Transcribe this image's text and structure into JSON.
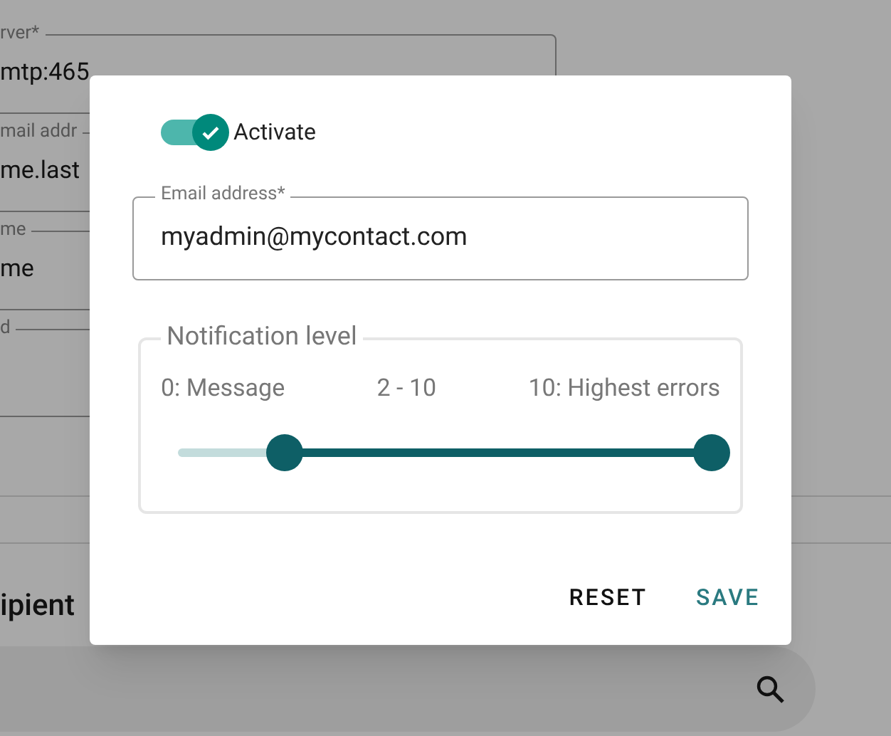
{
  "background_form": {
    "fields": [
      {
        "label": "rver*",
        "value": "mtp:465"
      },
      {
        "label": "mail addr",
        "value": "me.last"
      },
      {
        "label": "me",
        "value": "me"
      },
      {
        "label": "d"
      }
    ]
  },
  "section_title": "ipient",
  "dialog": {
    "activate": {
      "label": "Activate",
      "on": true
    },
    "email": {
      "label": "Email address*",
      "value": "myadmin@mycontact.com"
    },
    "notification": {
      "title": "Notification level",
      "labels": [
        "0: Message",
        "2 - 10",
        "10: Highest errors"
      ],
      "thumbs": [
        {
          "level": 0.2
        },
        {
          "level": 1
        }
      ]
    },
    "buttons": [
      {
        "label": "RESET",
        "kind": "plain"
      },
      {
        "label": "SAVE",
        "kind": "primary"
      }
    ]
  }
}
